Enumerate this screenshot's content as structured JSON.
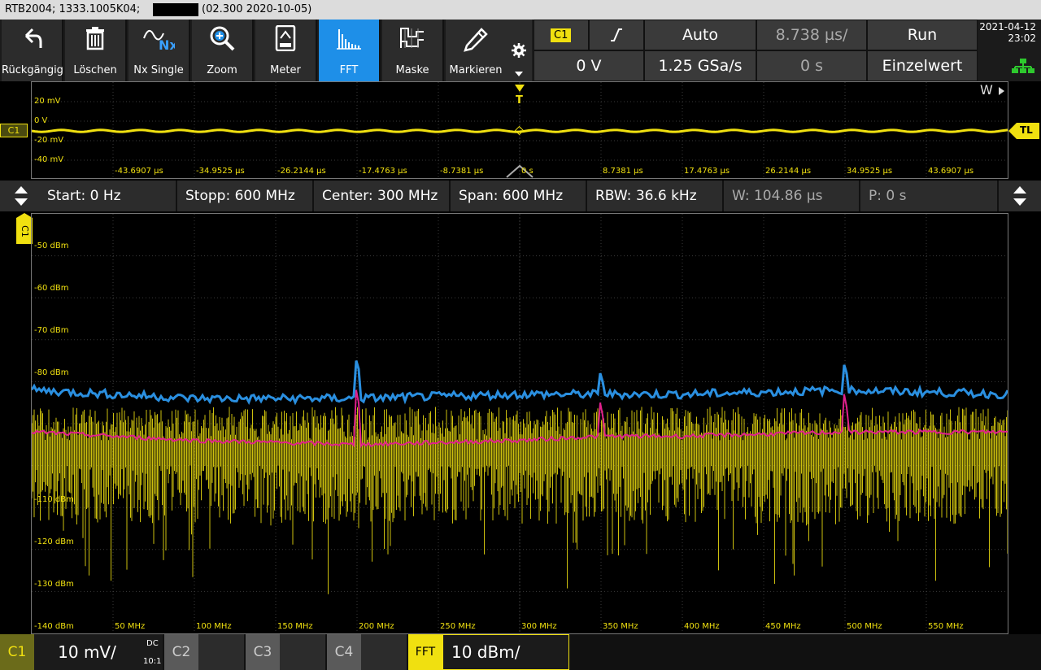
{
  "titlebar": {
    "device": "RTB2004; 1333.1005K04;",
    "firmware": "(02.300 2020-10-05)"
  },
  "toolbar": {
    "buttons": [
      {
        "label": "Rückgängig",
        "icon": "undo-icon"
      },
      {
        "label": "Löschen",
        "icon": "trash-icon"
      },
      {
        "label": "Nx Single",
        "icon": "nx-single-icon"
      },
      {
        "label": "Zoom",
        "icon": "zoom-icon"
      },
      {
        "label": "Meter",
        "icon": "meter-icon"
      },
      {
        "label": "FFT",
        "icon": "fft-icon",
        "active": true
      },
      {
        "label": "Maske",
        "icon": "mask-icon"
      },
      {
        "label": "Markieren",
        "icon": "marker-icon"
      }
    ],
    "settings_icon": "gear-icon"
  },
  "trigger": {
    "source": "C1",
    "slope_icon": "rising-edge-icon",
    "mode": "Auto",
    "level": "0 V",
    "sample_rate": "1.25 GSa/s",
    "time_div": "8.738 µs/",
    "position": "0 s",
    "run_state": "Run",
    "acq_mode": "Einzelwert"
  },
  "clock": {
    "date": "2021-04-12",
    "time": "23:02",
    "network_icon": "network-icon"
  },
  "wave": {
    "channel": "C1",
    "window_label": "W",
    "trigger_marker": "T",
    "trigger_level_label": "TL",
    "y_labels": [
      "20 mV",
      "0 V",
      "-20 mV",
      "-40 mV"
    ],
    "x_labels": [
      "-43.6907 µs",
      "-34.9525 µs",
      "-26.2144 µs",
      "-17.4763 µs",
      "-8.7381 µs",
      "0 s",
      "8.7381 µs",
      "17.4763 µs",
      "26.2144 µs",
      "34.9525 µs",
      "43.6907 µs"
    ]
  },
  "fft_info": {
    "start": "Start: 0 Hz",
    "stop": "Stopp: 600 MHz",
    "center": "Center: 300 MHz",
    "span": "Span: 600 MHz",
    "rbw": "RBW: 36.6 kHz",
    "window": "W: 104.86 µs",
    "position": "P: 0 s"
  },
  "fft": {
    "channel": "C1",
    "y_labels": [
      "-50 dBm",
      "-60 dBm",
      "-70 dBm",
      "-80 dBm",
      "-110 dBm",
      "-120 dBm",
      "-130 dBm",
      "-140 dBm"
    ],
    "x_labels": [
      "50 MHz",
      "100 MHz",
      "150 MHz",
      "200 MHz",
      "250 MHz",
      "300 MHz",
      "350 MHz",
      "400 MHz",
      "450 MHz",
      "500 MHz",
      "550 MHz"
    ]
  },
  "bottom": {
    "c1": {
      "label": "C1",
      "scale": "10 mV/",
      "coupling": "DC",
      "probe": "10:1"
    },
    "c2": "C2",
    "c3": "C3",
    "c4": "C4",
    "fft": {
      "label": "FFT",
      "scale": "10 dBm/"
    }
  },
  "colors": {
    "c1": "#f0e010",
    "accent": "#1e8fe8",
    "max_hold": "#2a8fe0",
    "average": "#e0208c"
  },
  "chart_data": {
    "type": "line",
    "x_unit": "MHz",
    "xlim": [
      0,
      600
    ],
    "ylim": [
      -140,
      -40
    ],
    "grid": true,
    "series": [
      {
        "color": "#2a8fe0",
        "x": [
          0,
          100,
          200,
          300,
          350,
          400,
          500,
          600
        ],
        "values": [
          -82,
          -84,
          -84,
          -83,
          -83,
          -83,
          -82,
          -83
        ]
      },
      {
        "color": "#e0208c",
        "x": [
          0,
          100,
          200,
          300,
          350,
          400,
          500,
          600
        ],
        "values": [
          -92,
          -94,
          -95,
          -94,
          -93,
          -93,
          -92,
          -92
        ]
      }
    ],
    "peaks": [
      {
        "x": 200,
        "y": -73
      },
      {
        "x": 350,
        "y": -76
      },
      {
        "x": 500,
        "y": -74
      }
    ]
  }
}
